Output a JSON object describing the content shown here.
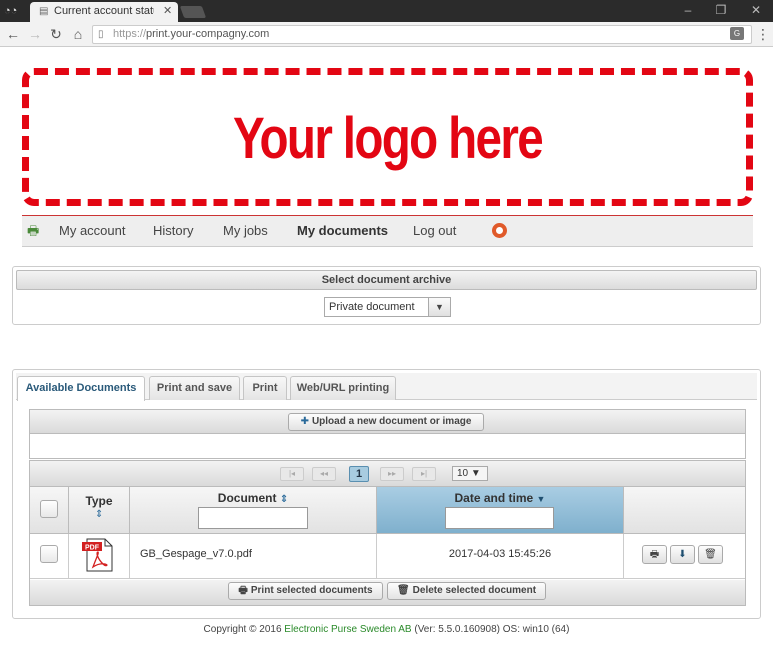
{
  "browser": {
    "tab_title": "Current account status f",
    "url_secure": "https://",
    "url_host": "print.your-compagny.com",
    "translate_glyph": "G"
  },
  "logo": {
    "text": "Your logo here",
    "color": "#e30613"
  },
  "nav": {
    "items": [
      {
        "label": "My account"
      },
      {
        "label": "History"
      },
      {
        "label": "My jobs"
      },
      {
        "label": "My documents"
      },
      {
        "label": "Log out"
      }
    ],
    "active": "My documents"
  },
  "archive": {
    "header": "Select document archive",
    "selected": "Private document"
  },
  "tabs": [
    {
      "label": "Available Documents"
    },
    {
      "label": "Print and save"
    },
    {
      "label": "Print"
    },
    {
      "label": "Web/URL printing"
    }
  ],
  "upload_label": "Upload a new document or image",
  "pager": {
    "current_page": "1",
    "page_size": "10"
  },
  "columns": {
    "type": "Type",
    "document": "Document",
    "datetime": "Date and time"
  },
  "rows": [
    {
      "type": "PDF",
      "document": "GB_Gespage_v7.0.pdf",
      "datetime": "2017-04-03 15:45:26"
    }
  ],
  "footer_buttons": {
    "print_selected": "Print selected documents",
    "delete_selected": "Delete selected document"
  },
  "copyright": {
    "prefix": "Copyright © 2016",
    "company": "Electronic Purse Sweden AB",
    "suffix": "(Ver: 5.5.0.160908) OS: win10 (64)"
  },
  "colors": {
    "accent_red": "#e30613",
    "header_blue": "#7fb0cd",
    "link_green": "#2a8a2a"
  }
}
